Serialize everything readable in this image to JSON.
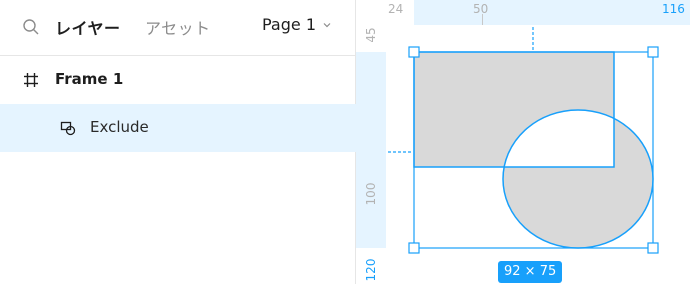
{
  "header": {
    "tab_layers": "レイヤー",
    "tab_assets": "アセット",
    "page_selector": "Page 1"
  },
  "layers": [
    {
      "label": "Frame 1",
      "icon": "frame-icon"
    },
    {
      "label": "Exclude",
      "icon": "boolean-exclude-icon",
      "selected": true
    }
  ],
  "canvas": {
    "ruler_top": {
      "label_24": "24",
      "label_50": "50",
      "label_116": "116"
    },
    "ruler_left": {
      "label_45": "45",
      "label_100": "100",
      "label_120": "120"
    },
    "selection_size": "92 × 75"
  },
  "colors": {
    "accent": "#18a0fb",
    "shape_fill": "#d9d9d9",
    "selection_bg": "#e5f4ff"
  }
}
